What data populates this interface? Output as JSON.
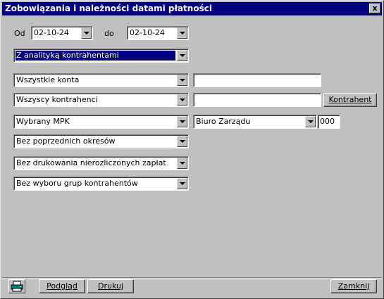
{
  "window": {
    "title": "Zobowiązania i należności datami płatności",
    "close_symbol": "x"
  },
  "dates": {
    "from_label": "Od",
    "from_value": "02-10-24",
    "to_label": "do",
    "to_value": "02-10-24"
  },
  "filters": {
    "analytics": "Z analityką kontrahentami",
    "accounts": "Wszystkie konta",
    "accounts_text": "",
    "contractors": "Wszyscy kontrahenci",
    "contractors_text": "",
    "contractor_button": "Kontrahent",
    "mpk": "Wybrany MPK",
    "mpk_unit": "Biuro Zarządu",
    "mpk_code": "000",
    "periods": "Bez poprzednich okresów",
    "printing": "Bez drukowania nierozliczonych zapłat",
    "groups": "Bez wyboru grup kontrahentów"
  },
  "footer": {
    "printer_icon": "printer-icon",
    "preview_label": "Podgląd",
    "print_label": "Drukuj",
    "close_label": "Zamknij"
  },
  "colors": {
    "title_bar": "#000080",
    "face": "#c0c0c0",
    "selection": "#000080"
  }
}
